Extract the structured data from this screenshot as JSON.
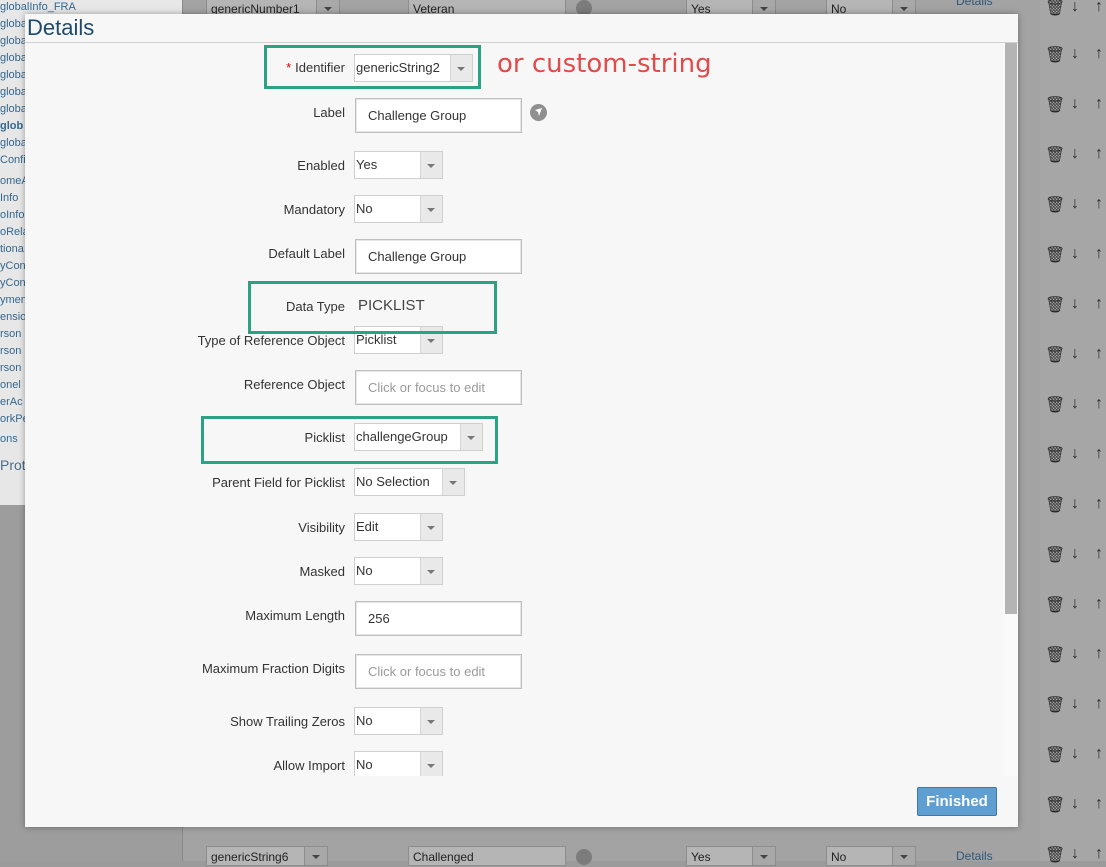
{
  "dialog": {
    "title": "Details",
    "finished_label": "Finished"
  },
  "annotation": {
    "text": "or custom-string",
    "highlight_color": "#2aa383",
    "text_color": "#e24b4b"
  },
  "fields": {
    "identifier": {
      "label": "Identifier",
      "required_mark": "*",
      "value": "genericString2"
    },
    "label": {
      "label": "Label",
      "value": "Challenge Group"
    },
    "enabled": {
      "label": "Enabled",
      "value": "Yes"
    },
    "mandatory": {
      "label": "Mandatory",
      "value": "No"
    },
    "default_label": {
      "label": "Default Label",
      "value": "Challenge Group"
    },
    "data_type": {
      "label": "Data Type",
      "value": "PICKLIST"
    },
    "type_of_reference_object": {
      "label": "Type of Reference Object",
      "value": "Picklist"
    },
    "reference_object": {
      "label": "Reference Object",
      "placeholder": "Click or focus to edit"
    },
    "picklist": {
      "label": "Picklist",
      "value": "challengeGroup"
    },
    "parent_field_for_picklist": {
      "label": "Parent Field for Picklist",
      "value": "No Selection"
    },
    "visibility": {
      "label": "Visibility",
      "value": "Edit"
    },
    "masked": {
      "label": "Masked",
      "value": "No"
    },
    "maximum_length": {
      "label": "Maximum Length",
      "value": "256"
    },
    "maximum_fraction_digits": {
      "label": "Maximum Fraction Digits",
      "placeholder": "Click or focus to edit"
    },
    "show_trailing_zeros": {
      "label": "Show Trailing Zeros",
      "value": "No"
    },
    "allow_import": {
      "label": "Allow Import",
      "value": "No"
    }
  },
  "background": {
    "nav_items": [
      "globalInfo_FRA",
      "globa",
      "globa",
      "globa",
      "globa",
      "globa",
      "globa",
      "glob",
      "globa",
      "Confi",
      "omeA",
      "Info",
      "oInfo",
      "oRela",
      "tiona",
      "yCon",
      "yCon",
      "ymen",
      "ensio",
      "rson",
      "rson",
      "rson",
      "onel",
      "erAc",
      "orkPe",
      "ons"
    ],
    "nav_bottom": "Prot",
    "top_row": {
      "identifier": "genericNumber1",
      "label": "Veteran",
      "enabled": "Yes",
      "mandatory": "No",
      "details": "Details"
    },
    "bottom_row": {
      "identifier": "genericString6",
      "label": "Challenged",
      "enabled": "Yes",
      "mandatory": "No",
      "details": "Details"
    }
  },
  "icons": [
    "trash-icon",
    "arrow-down-icon",
    "arrow-up-icon",
    "pin-icon",
    "dropdown-chevron-icon"
  ]
}
